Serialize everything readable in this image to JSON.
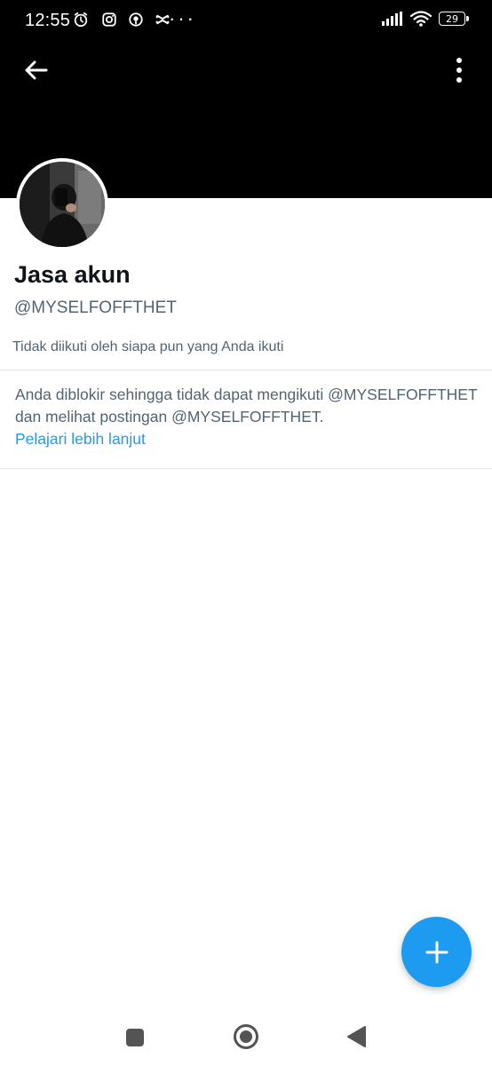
{
  "status_bar": {
    "time": "12:55",
    "battery": "29",
    "overflow": "···",
    "left_icons": [
      "alarm-icon",
      "instagram-icon",
      "location-icon",
      "capcut-icon"
    ],
    "right_icons": [
      "signal-icon",
      "wifi-icon",
      "battery-icon"
    ]
  },
  "header": {
    "back_icon": "arrow-left-icon",
    "more_icon": "more-vertical-icon",
    "banner_color": "#000000"
  },
  "profile": {
    "display_name": "Jasa akun",
    "handle": "@MYSELFOFFTHET",
    "follow_info": "Tidak diikuti oleh siapa pun yang Anda ikuti"
  },
  "blocked_notice": {
    "text": "Anda diblokir sehingga tidak dapat mengikuti @MYSELFOFFTHET dan melihat postingan @MYSELFOFFTHET.",
    "link": "Pelajari lebih lanjut"
  },
  "fab": {
    "icon": "plus-icon",
    "color": "#1d9bf0"
  },
  "system_nav": {
    "icons": [
      "recents-square-icon",
      "home-circle-icon",
      "back-triangle-icon"
    ]
  },
  "colors": {
    "accent": "#1d9bf0",
    "primary_text": "#0f1419",
    "secondary_text": "#536471"
  }
}
